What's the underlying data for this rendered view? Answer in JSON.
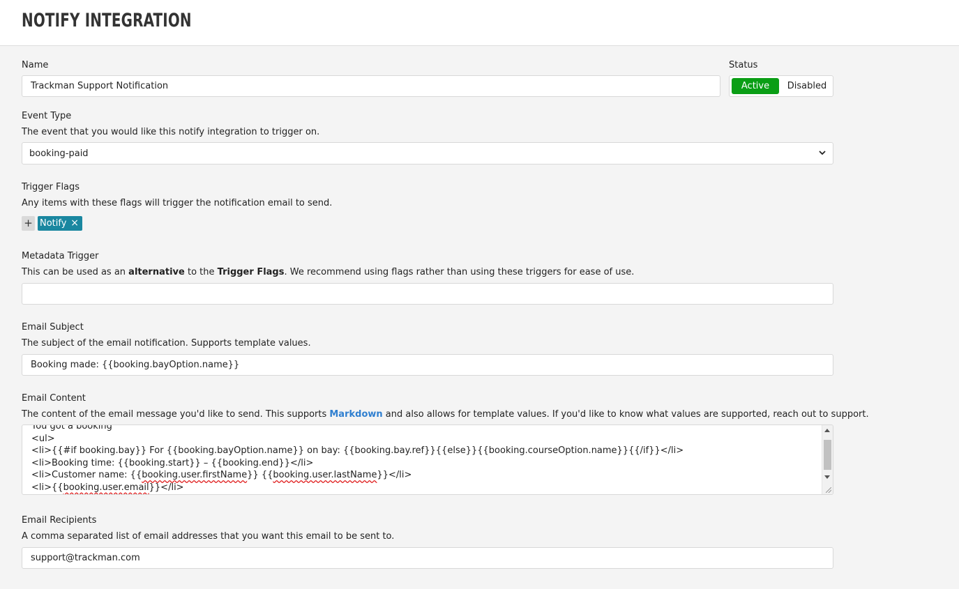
{
  "header": {
    "title": "NOTIFY INTEGRATION"
  },
  "name_field": {
    "label": "Name",
    "value": "Trackman Support Notification"
  },
  "status": {
    "label": "Status",
    "active_label": "Active",
    "disabled_label": "Disabled",
    "selected": "Active",
    "active_color": "#0a9e15"
  },
  "event_type": {
    "label": "Event Type",
    "help": "The event that you would like this notify integration to trigger on.",
    "selected": "booking-paid"
  },
  "trigger_flags": {
    "label": "Trigger Flags",
    "help": "Any items with these flags will trigger the notification email to send.",
    "add_label": "+",
    "flags": [
      {
        "label": "Notify",
        "remove": "×",
        "color": "#1a87a0"
      }
    ]
  },
  "metadata_trigger": {
    "label": "Metadata Trigger",
    "help_prefix": "This can be used as an ",
    "help_bold1": "alternative",
    "help_mid": " to the ",
    "help_bold2": "Trigger Flags",
    "help_suffix": ". We recommend using flags rather than using these triggers for ease of use.",
    "value": ""
  },
  "email_subject": {
    "label": "Email Subject",
    "help": "The subject of the email notification. Supports template values.",
    "value": "Booking made: {{booking.bayOption.name}}"
  },
  "email_content": {
    "label": "Email Content",
    "help_prefix": "The content of the email message you'd like to send. This supports ",
    "help_link": "Markdown",
    "help_suffix": " and also allows for template values. If you'd like to know what values are supported, reach out to support.",
    "lines": {
      "l0": "You got a booking",
      "l1": "<ul>",
      "l2": "<li>{{#if booking.bay}} For {{booking.bayOption.name}} on bay: {{booking.bay.ref}}{{else}}{{booking.courseOption.name}}{{/if}}</li>",
      "l3": "<li>Booking time: {{booking.start}} – {{booking.end}}</li>",
      "l4a": "<li>Customer name: {{",
      "l4b": "booking.user.firstName",
      "l4c": "}} {{",
      "l4d": "booking.user.lastName",
      "l4e": "}}</li>",
      "l5a": "<li>{{",
      "l5b": "booking.user.email",
      "l5c": "}}</li>"
    }
  },
  "email_recipients": {
    "label": "Email Recipients",
    "help": "A comma separated list of email addresses that you want this email to be sent to.",
    "value": "support@trackman.com"
  }
}
